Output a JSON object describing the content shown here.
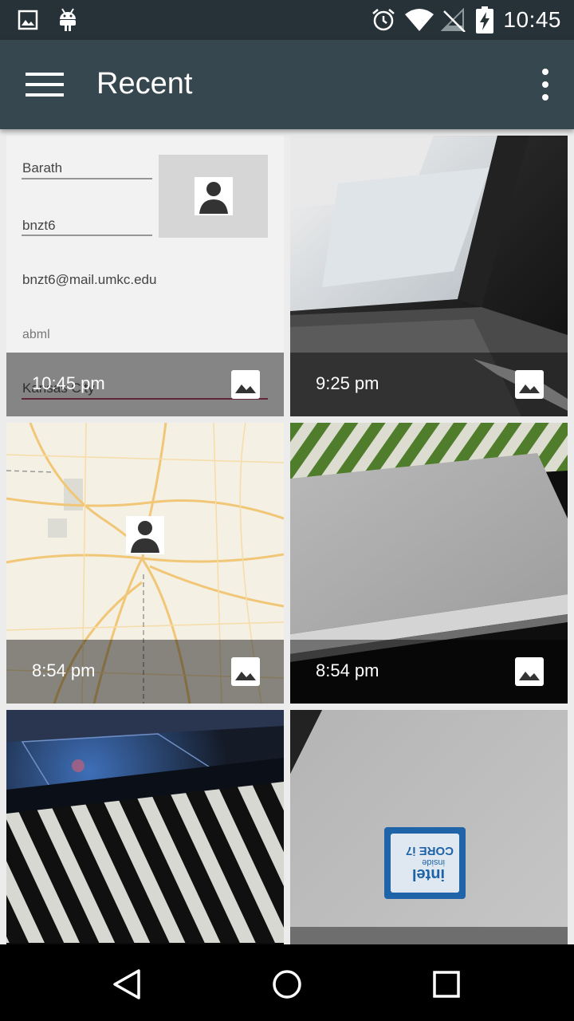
{
  "status_bar": {
    "time": "10:45",
    "icons": [
      "gallery-notification-icon",
      "android-notification-icon",
      "alarm-icon",
      "wifi-icon",
      "no-signal-icon",
      "battery-charging-icon"
    ]
  },
  "toolbar": {
    "title": "Recent",
    "menu_icon": "hamburger-menu-icon",
    "overflow_icon": "more-vert-icon"
  },
  "photos": [
    {
      "time": "10:45 pm",
      "type_icon": "image-icon"
    },
    {
      "time": "9:25 pm",
      "type_icon": "image-icon"
    },
    {
      "time": "8:54 pm",
      "type_icon": "image-icon"
    },
    {
      "time": "8:54 pm",
      "type_icon": "image-icon"
    },
    {
      "time": "",
      "type_icon": "image-icon"
    },
    {
      "time": "",
      "type_icon": "image-icon"
    }
  ],
  "screenshot_content": {
    "name": "Barath",
    "username": "bnzt6",
    "email": "bnzt6@mail.umkc.edu",
    "field4": "abml",
    "field5": "Kansas City"
  },
  "chip_text": {
    "line1": "intel",
    "line2": "CORE i7",
    "line3": "inside"
  },
  "nav_bar": {
    "back_icon": "back-icon",
    "home_icon": "home-icon",
    "recents_icon": "recents-icon"
  }
}
